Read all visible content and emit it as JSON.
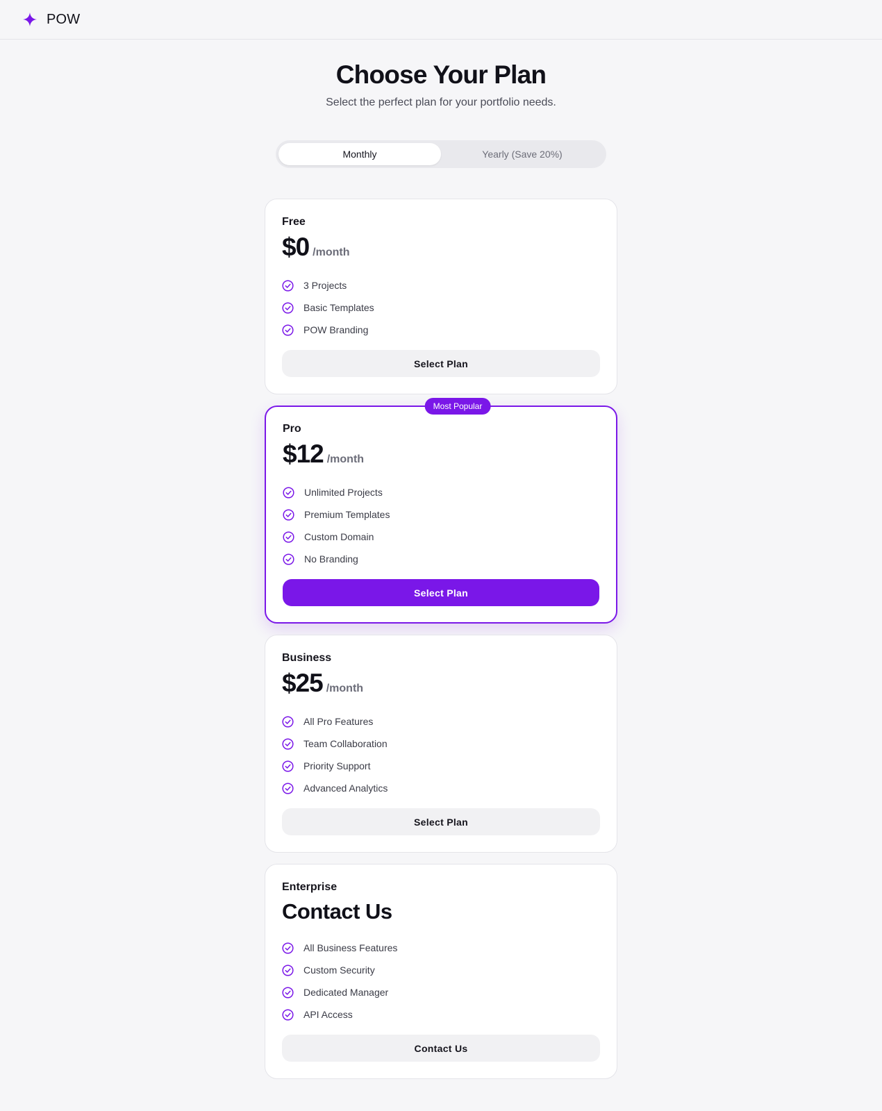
{
  "brand": {
    "name": "POW",
    "icon": "sparkle-icon",
    "accent": "#7a17e8"
  },
  "hero": {
    "title": "Choose Your Plan",
    "subtitle": "Select the perfect plan for your portfolio needs."
  },
  "billing_toggle": {
    "options": [
      "Monthly",
      "Yearly (Save 20%)"
    ],
    "selected": "Monthly"
  },
  "plans": [
    {
      "name": "Free",
      "price": "$0",
      "period": "/month",
      "features": [
        "3 Projects",
        "Basic Templates",
        "POW Branding"
      ],
      "button": "Select Plan"
    },
    {
      "name": "Pro",
      "badge": "Most Popular",
      "price": "$12",
      "period": "/month",
      "features": [
        "Unlimited Projects",
        "Premium Templates",
        "Custom Domain",
        "No Branding"
      ],
      "button": "Select Plan"
    },
    {
      "name": "Business",
      "price": "$25",
      "period": "/month",
      "features": [
        "All Pro Features",
        "Team Collaboration",
        "Priority Support",
        "Advanced Analytics"
      ],
      "button": "Select Plan"
    },
    {
      "name": "Enterprise",
      "price": "Contact Us",
      "features": [
        "All Business Features",
        "Custom Security",
        "Dedicated Manager",
        "API Access"
      ],
      "button": "Contact Us"
    }
  ]
}
